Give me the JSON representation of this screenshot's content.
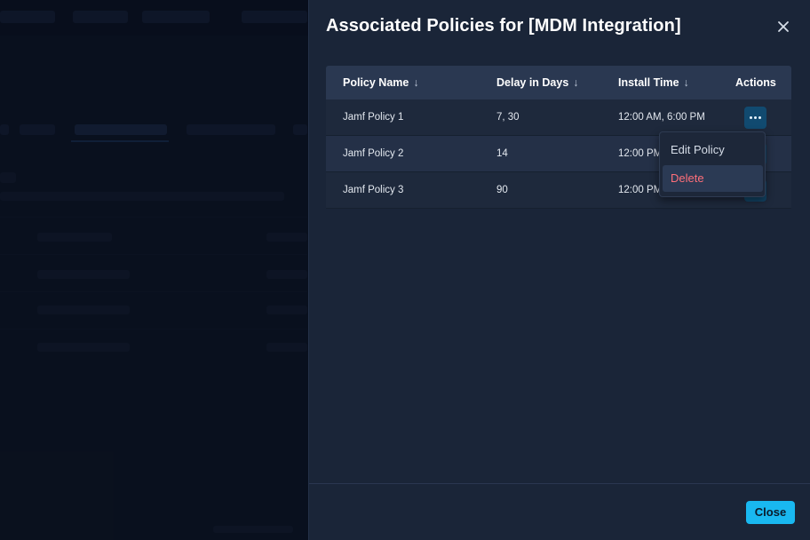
{
  "drawer": {
    "title": "Associated Policies for [MDM Integration]",
    "close_icon": "close-icon"
  },
  "table": {
    "columns": [
      {
        "label": "Policy Name",
        "sort_icon": "arrow-down-icon"
      },
      {
        "label": "Delay in Days",
        "sort_icon": "arrow-down-icon"
      },
      {
        "label": "Install Time",
        "sort_icon": "arrow-down-icon"
      },
      {
        "label": "Actions"
      }
    ],
    "rows": [
      {
        "policy": "Jamf Policy 1",
        "delay": "7, 30",
        "time": "12:00 AM, 6:00 PM"
      },
      {
        "policy": "Jamf Policy 2",
        "delay": "14",
        "time": "12:00 PM"
      },
      {
        "policy": "Jamf Policy 3",
        "delay": "90",
        "time": "12:00 PM"
      }
    ],
    "sort_arrow": "↓",
    "actions_icon": "more-horizontal-icon"
  },
  "menu": {
    "items": [
      {
        "label": "Edit Policy"
      },
      {
        "label": "Delete"
      }
    ]
  },
  "footer": {
    "close_label": "Close"
  },
  "colors": {
    "accent": "#19b8f0",
    "danger": "#ff6f7a",
    "drawer_bg": "#1a2538",
    "header_bg": "#2a3851"
  }
}
